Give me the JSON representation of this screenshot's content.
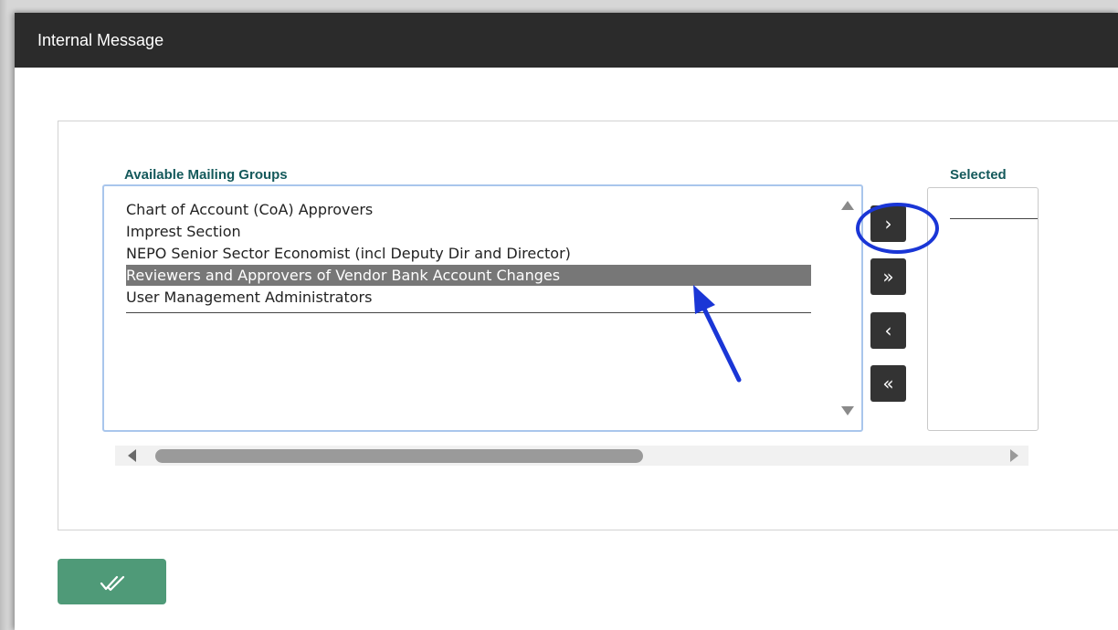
{
  "dialog": {
    "title": "Internal Message"
  },
  "available": {
    "label": "Available Mailing Groups",
    "items": [
      "Chart of Account (CoA) Approvers",
      "Imprest Section",
      "NEPO Senior Sector Economist (incl Deputy Dir and Director)",
      "Reviewers and Approvers of Vendor Bank Account Changes",
      "User Management Administrators"
    ],
    "selected_item": "Reviewers and Approvers of Vendor Bank Account Changes"
  },
  "selected": {
    "label": "Selected"
  },
  "move_buttons": {
    "add_one": "›",
    "add_all": "»",
    "remove_one": "‹",
    "remove_all": "«"
  },
  "actions": {
    "confirm_icon": "double-check-icon"
  },
  "annotations": {
    "highlight_color": "#1a36d6"
  }
}
